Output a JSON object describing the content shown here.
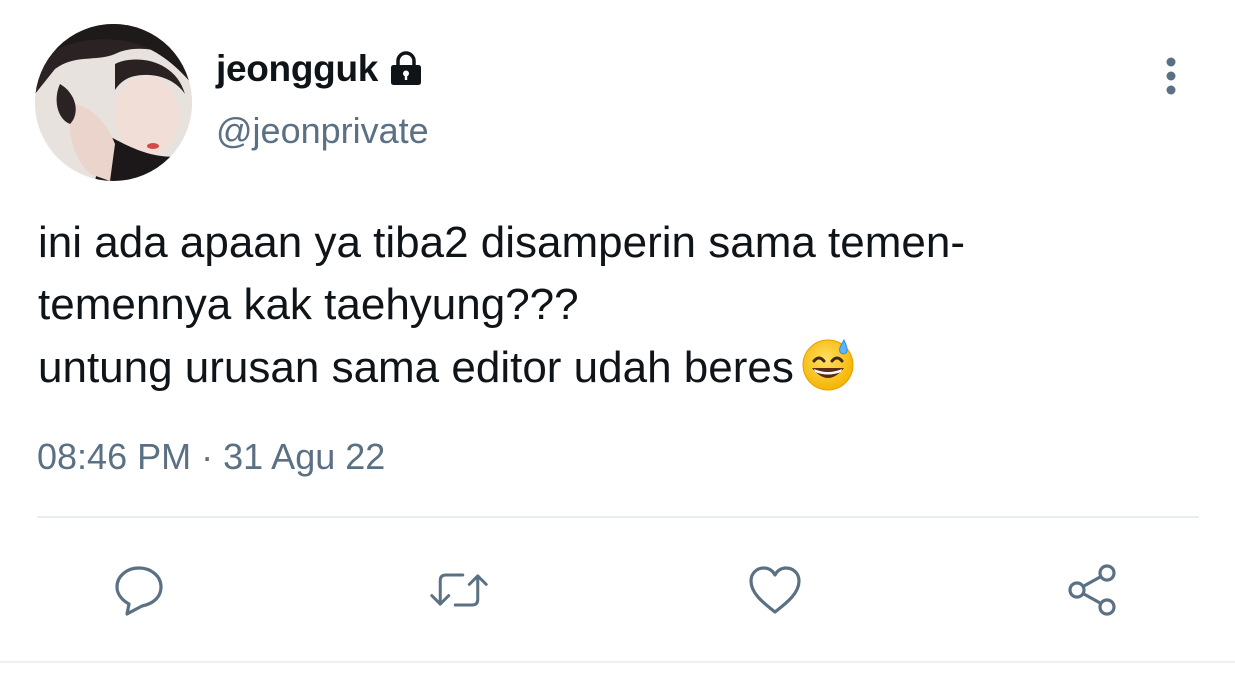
{
  "tweet": {
    "author": {
      "display_name": "jeongguk",
      "handle": "@jeonprivate",
      "protected": true
    },
    "text_lines": [
      "ini ada apaan ya tiba2 disamperin sama temen-",
      "temennya kak taehyung???",
      "untung urusan sama editor udah beres"
    ],
    "emoji": "grinning-face-with-sweat-emoji",
    "time": "08:46 PM",
    "separator": "·",
    "date": "31 Agu 22"
  },
  "icons": {
    "lock": "lock-icon",
    "more": "more-vertical-icon",
    "reply": "reply-icon",
    "retweet": "retweet-icon",
    "like": "heart-icon",
    "share": "share-icon"
  },
  "colors": {
    "text": "#0f1419",
    "secondary": "#5b7083",
    "divider": "#e6ecf0"
  }
}
